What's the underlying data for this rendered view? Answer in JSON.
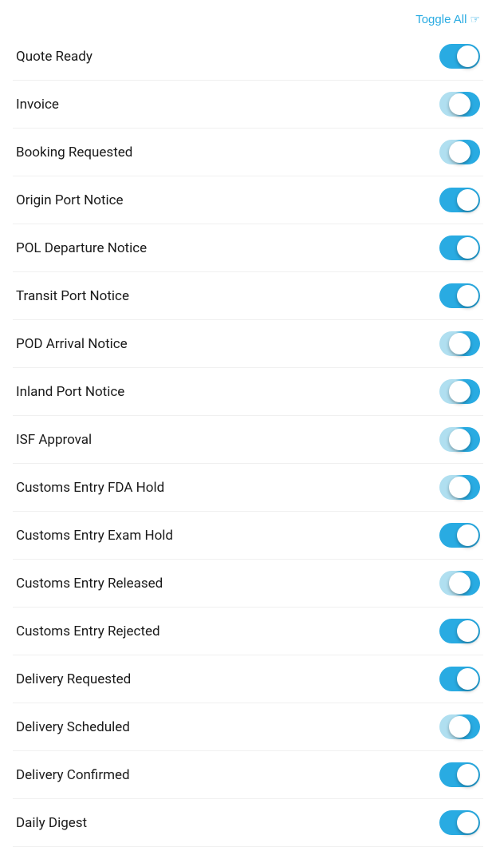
{
  "header": {
    "toggle_all_label": "Toggle All"
  },
  "items": [
    {
      "id": "quote-ready",
      "label": "Quote Ready",
      "state": "on"
    },
    {
      "id": "invoice",
      "label": "Invoice",
      "state": "half"
    },
    {
      "id": "booking-requested",
      "label": "Booking Requested",
      "state": "half"
    },
    {
      "id": "origin-port-notice",
      "label": "Origin Port Notice",
      "state": "on"
    },
    {
      "id": "pol-departure-notice",
      "label": "POL Departure Notice",
      "state": "on"
    },
    {
      "id": "transit-port-notice",
      "label": "Transit Port Notice",
      "state": "on"
    },
    {
      "id": "pod-arrival-notice",
      "label": "POD Arrival Notice",
      "state": "half"
    },
    {
      "id": "inland-port-notice",
      "label": "Inland Port Notice",
      "state": "half"
    },
    {
      "id": "isf-approval",
      "label": "ISF Approval",
      "state": "half"
    },
    {
      "id": "customs-entry-fda-hold",
      "label": "Customs Entry FDA Hold",
      "state": "half"
    },
    {
      "id": "customs-entry-exam-hold",
      "label": "Customs Entry Exam Hold",
      "state": "on"
    },
    {
      "id": "customs-entry-released",
      "label": "Customs Entry Released",
      "state": "half"
    },
    {
      "id": "customs-entry-rejected",
      "label": "Customs Entry Rejected",
      "state": "on"
    },
    {
      "id": "delivery-requested",
      "label": "Delivery Requested",
      "state": "on"
    },
    {
      "id": "delivery-scheduled",
      "label": "Delivery Scheduled",
      "state": "half"
    },
    {
      "id": "delivery-confirmed",
      "label": "Delivery Confirmed",
      "state": "on"
    },
    {
      "id": "daily-digest",
      "label": "Daily Digest",
      "state": "on"
    }
  ]
}
